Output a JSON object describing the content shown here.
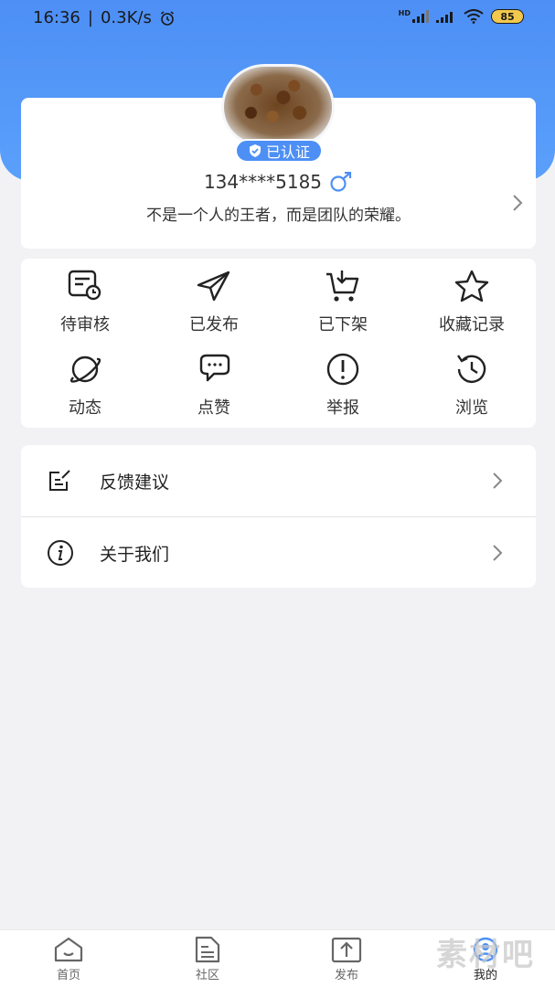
{
  "status_bar": {
    "time": "16:36",
    "separator": "|",
    "speed": "0.3K/s",
    "battery": "85",
    "hd_label": "HD"
  },
  "profile": {
    "verified_label": "已认证",
    "phone": "134****5185",
    "gender_icon": "male-icon",
    "motto": "不是一个人的王者，而是团队的荣耀。"
  },
  "grid": {
    "items": [
      {
        "label": "待审核",
        "icon": "pending-review-icon"
      },
      {
        "label": "已发布",
        "icon": "paper-plane-icon"
      },
      {
        "label": "已下架",
        "icon": "cart-download-icon"
      },
      {
        "label": "收藏记录",
        "icon": "star-icon"
      },
      {
        "label": "动态",
        "icon": "planet-icon"
      },
      {
        "label": "点赞",
        "icon": "chat-bubbles-icon"
      },
      {
        "label": "举报",
        "icon": "exclamation-circle-icon"
      },
      {
        "label": "浏览",
        "icon": "history-icon"
      }
    ]
  },
  "menu": {
    "items": [
      {
        "label": "反馈建议",
        "icon": "feedback-edit-icon"
      },
      {
        "label": "关于我们",
        "icon": "info-circle-icon"
      }
    ]
  },
  "bottom_nav": {
    "items": [
      {
        "label": "首页",
        "icon": "home-icon"
      },
      {
        "label": "社区",
        "icon": "document-icon"
      },
      {
        "label": "发布",
        "icon": "upload-icon"
      },
      {
        "label": "我的",
        "icon": "profile-icon",
        "active": true
      }
    ]
  },
  "watermark": "素材吧",
  "colors": {
    "accent": "#4d8ff5",
    "background": "#f2f2f4",
    "card": "#ffffff"
  }
}
